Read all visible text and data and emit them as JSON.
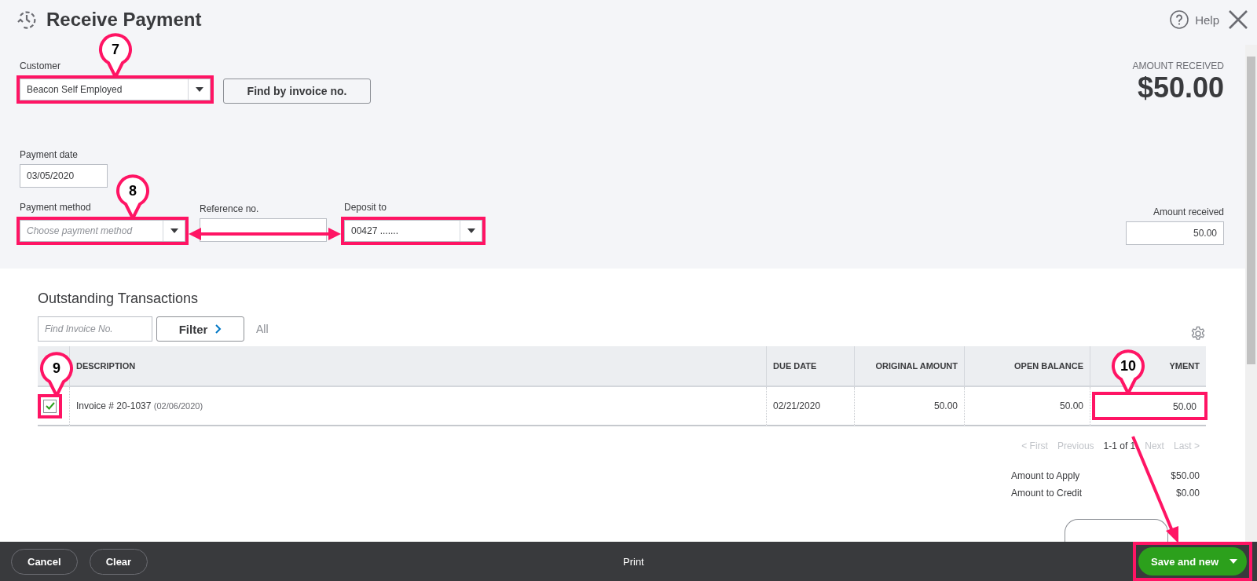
{
  "header": {
    "title": "Receive Payment",
    "help": "Help"
  },
  "customer": {
    "label": "Customer",
    "value": "Beacon Self Employed"
  },
  "find_button": "Find by invoice no.",
  "amount_summary": {
    "label": "AMOUNT RECEIVED",
    "value": "$50.00"
  },
  "payment_date": {
    "label": "Payment date",
    "value": "03/05/2020"
  },
  "payment_method": {
    "label": "Payment method",
    "placeholder": "Choose payment method"
  },
  "reference": {
    "label": "Reference no."
  },
  "deposit_to": {
    "label": "Deposit to",
    "value": "00427 ......."
  },
  "amount_received": {
    "label": "Amount received",
    "value": "50.00"
  },
  "outstanding": {
    "title": "Outstanding Transactions",
    "search": {
      "placeholder": "Find Invoice No."
    },
    "filter": "Filter",
    "filter_value": "All",
    "table": {
      "columns": [
        "DESCRIPTION",
        "DUE DATE",
        "ORIGINAL AMOUNT",
        "OPEN BALANCE",
        "YMENT"
      ],
      "rows": [
        {
          "checked": true,
          "description": "Invoice # 20-1037",
          "invoice_date": "(02/06/2020)",
          "due_date": "02/21/2020",
          "original_amount": "50.00",
          "open_balance": "50.00",
          "payment": "50.00"
        }
      ]
    },
    "pagination": [
      {
        "label": "< First",
        "disabled": true
      },
      {
        "label": "Previous",
        "disabled": true
      },
      {
        "label": "1-1 of 1",
        "disabled": false
      },
      {
        "label": "Next",
        "disabled": true
      },
      {
        "label": "Last >",
        "disabled": true
      }
    ],
    "totals": [
      {
        "label": "Amount to Apply",
        "value": "$50.00"
      },
      {
        "label": "Amount to Credit",
        "value": "$0.00"
      }
    ]
  },
  "footer": {
    "cancel": "Cancel",
    "clear": "Clear",
    "print": "Print",
    "save": "Save and new"
  },
  "callouts": [
    "7",
    "8",
    "9",
    "10"
  ]
}
